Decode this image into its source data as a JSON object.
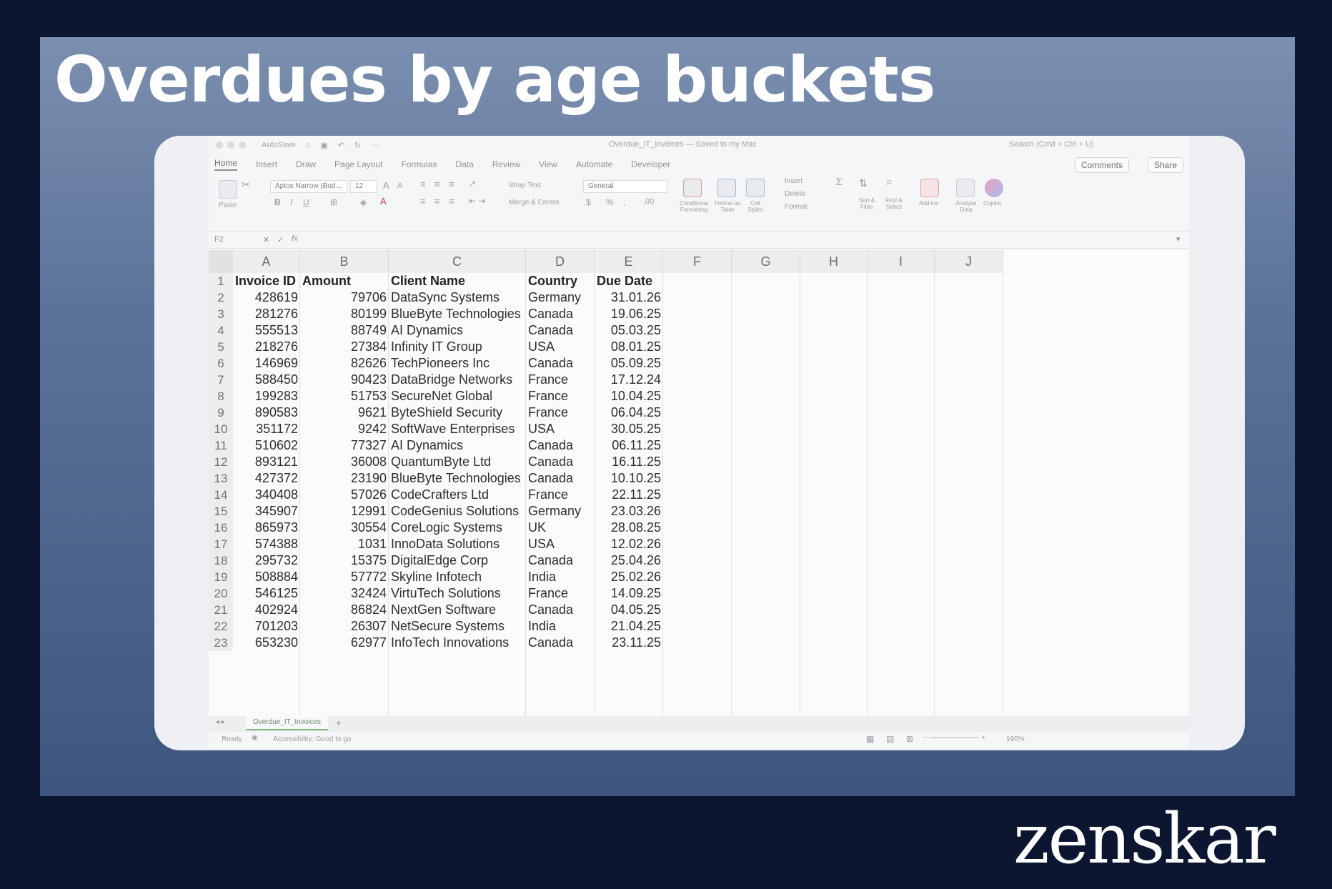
{
  "slide": {
    "title": "Overdues by age buckets"
  },
  "brand": {
    "logo_text": "zenskar"
  },
  "window": {
    "autosave": "AutoSave",
    "doc_title": "Overdue_IT_Invoices — Saved to my Mac",
    "search_placeholder": "Search (Cmd + Ctrl + U)"
  },
  "tabs": [
    "Home",
    "Insert",
    "Draw",
    "Page Layout",
    "Formulas",
    "Data",
    "Review",
    "View",
    "Automate",
    "Developer"
  ],
  "buttons": {
    "comments": "Comments",
    "share": "Share"
  },
  "ribbon": {
    "paste": "Paste",
    "font_name": "Aptos Narrow (Bod...",
    "font_size": "12",
    "wrap_text": "Wrap Text",
    "merge": "Merge & Centre",
    "number_format": "General",
    "conditional": "Conditional Formatting",
    "format_table": "Format as Table",
    "cell_styles": "Cell Styles",
    "insert": "Insert",
    "delete": "Delete",
    "format": "Format",
    "sort_filter": "Sort & Filter",
    "find_select": "Find & Select",
    "addins": "Add-ins",
    "analyse": "Analyse Data",
    "copilot": "Copilot"
  },
  "formula_bar": {
    "cell_ref": "F2",
    "fx": "fx"
  },
  "columns": [
    "A",
    "B",
    "C",
    "D",
    "E",
    "F",
    "G",
    "H",
    "I",
    "J"
  ],
  "headers": [
    "Invoice ID",
    "Amount",
    "Client Name",
    "Country",
    "Due Date"
  ],
  "rows": [
    [
      "428619",
      "79706",
      "DataSync Systems",
      "Germany",
      "31.01.26"
    ],
    [
      "281276",
      "80199",
      "BlueByte Technologies",
      "Canada",
      "19.06.25"
    ],
    [
      "555513",
      "88749",
      "AI Dynamics",
      "Canada",
      "05.03.25"
    ],
    [
      "218276",
      "27384",
      "Infinity IT Group",
      "USA",
      "08.01.25"
    ],
    [
      "146969",
      "82626",
      "TechPioneers Inc",
      "Canada",
      "05.09.25"
    ],
    [
      "588450",
      "90423",
      "DataBridge Networks",
      "France",
      "17.12.24"
    ],
    [
      "199283",
      "51753",
      "SecureNet Global",
      "France",
      "10.04.25"
    ],
    [
      "890583",
      "9621",
      "ByteShield Security",
      "France",
      "06.04.25"
    ],
    [
      "351172",
      "9242",
      "SoftWave Enterprises",
      "USA",
      "30.05.25"
    ],
    [
      "510602",
      "77327",
      "AI Dynamics",
      "Canada",
      "06.11.25"
    ],
    [
      "893121",
      "36008",
      "QuantumByte Ltd",
      "Canada",
      "16.11.25"
    ],
    [
      "427372",
      "23190",
      "BlueByte Technologies",
      "Canada",
      "10.10.25"
    ],
    [
      "340408",
      "57026",
      "CodeCrafters Ltd",
      "France",
      "22.11.25"
    ],
    [
      "345907",
      "12991",
      "CodeGenius Solutions",
      "Germany",
      "23.03.26"
    ],
    [
      "865973",
      "30554",
      "CoreLogic Systems",
      "UK",
      "28.08.25"
    ],
    [
      "574388",
      "1031",
      "InnoData Solutions",
      "USA",
      "12.02.26"
    ],
    [
      "295732",
      "15375",
      "DigitalEdge Corp",
      "Canada",
      "25.04.26"
    ],
    [
      "508884",
      "57772",
      "Skyline Infotech",
      "India",
      "25.02.26"
    ],
    [
      "546125",
      "32424",
      "VirtuTech Solutions",
      "France",
      "14.09.25"
    ],
    [
      "402924",
      "86824",
      "NextGen Software",
      "Canada",
      "04.05.25"
    ],
    [
      "701203",
      "26307",
      "NetSecure Systems",
      "India",
      "21.04.25"
    ],
    [
      "653230",
      "62977",
      "InfoTech Innovations",
      "Canada",
      "23.11.25"
    ]
  ],
  "sheet_tab": "Overdue_IT_Invoices",
  "status": {
    "ready": "Ready",
    "accessibility": "Accessibility: Good to go",
    "zoom": "190%"
  }
}
